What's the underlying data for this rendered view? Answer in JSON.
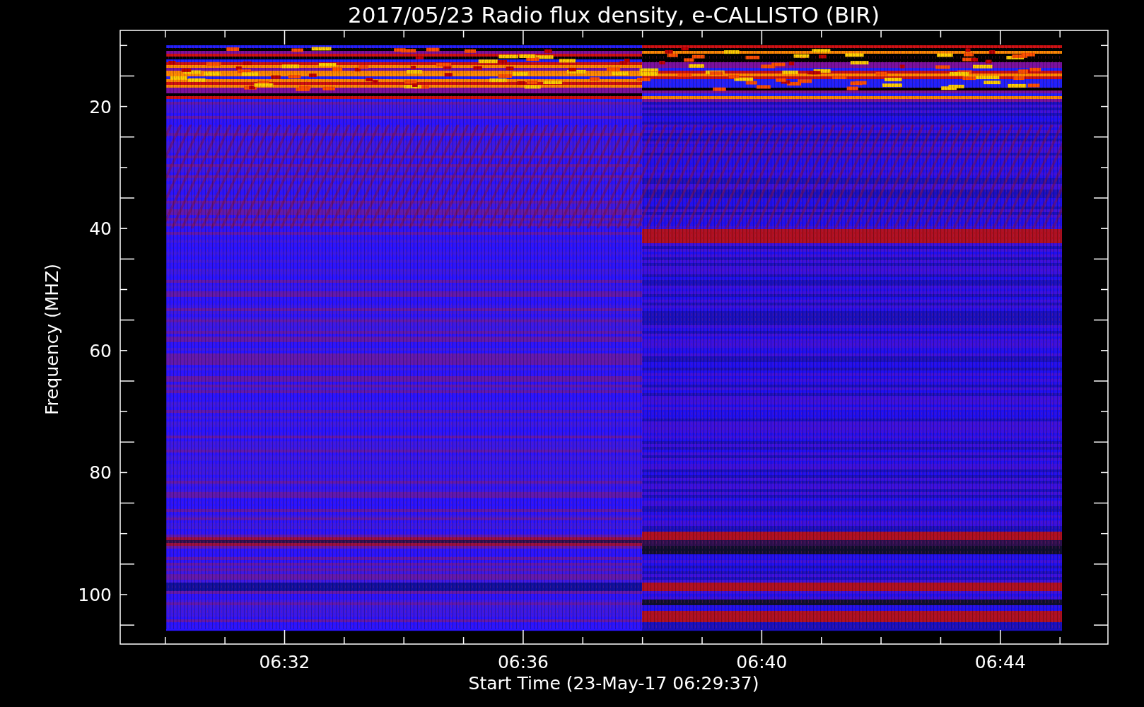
{
  "plot": {
    "title": "2017/05/23  Radio flux density, e-CALLISTO (BIR)",
    "xlabel": "Start Time (23-May-17 06:29:37)",
    "ylabel": "Frequency (MHZ)",
    "y_tick_labels": [
      "20",
      "40",
      "60",
      "80",
      "100"
    ],
    "x_tick_labels": [
      "06:32",
      "06:36",
      "06:40",
      "06:44"
    ]
  }
}
